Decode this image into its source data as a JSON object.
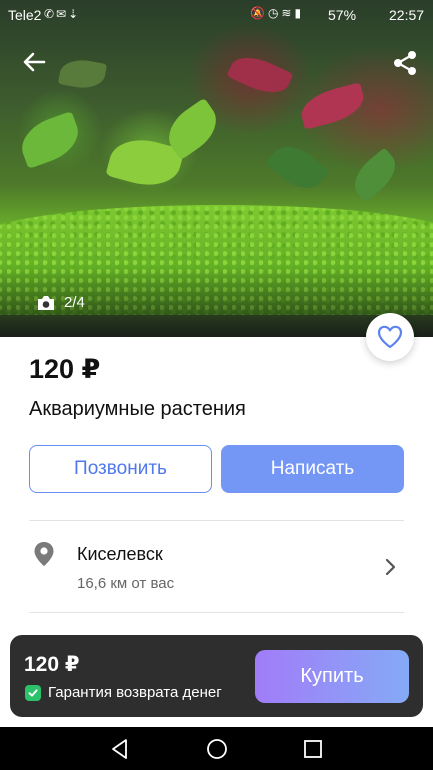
{
  "status_bar": {
    "carrier": "Tele2",
    "battery": "57%",
    "time": "22:57"
  },
  "photo": {
    "counter": "2/4"
  },
  "listing": {
    "price": "120 ₽",
    "title": "Аквариумные растения"
  },
  "actions": {
    "call_label": "Позвонить",
    "write_label": "Написать"
  },
  "location": {
    "city": "Киселевск",
    "distance": "16,6 км от вас"
  },
  "buy_panel": {
    "price": "120 ₽",
    "guarantee": "Гарантия возврата денег",
    "buy_label": "Купить"
  },
  "colors": {
    "accent": "#7497f5",
    "accent_outline": "#6a8df5",
    "buy_gradient_start": "#a17cf8",
    "buy_gradient_end": "#85aaf6",
    "guarantee_green": "#2cc26b",
    "panel_bg": "#2e2e2e"
  },
  "icons": {
    "back": "arrow-left-icon",
    "share": "share-icon",
    "camera": "camera-icon",
    "favorite": "heart-icon",
    "location": "location-pin-icon",
    "chevron": "chevron-right-icon",
    "shield": "check-shield-icon",
    "nav_back": "triangle-back-icon",
    "nav_home": "circle-home-icon",
    "nav_recents": "square-recents-icon"
  }
}
